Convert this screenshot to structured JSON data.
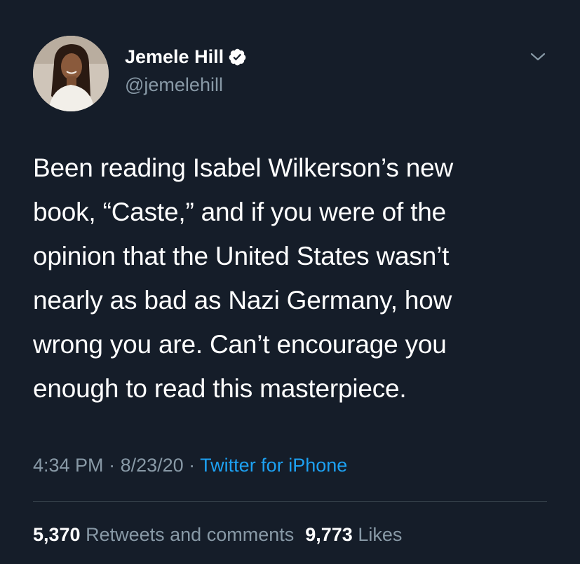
{
  "author": {
    "display_name": "Jemele Hill",
    "handle": "@jemelehill",
    "avatar_icon": "user-avatar",
    "verified_icon": "verified-badge-icon"
  },
  "menu": {
    "icon": "chevron-down-icon"
  },
  "tweet": {
    "lines": [
      "Been reading Isabel Wilkerson’s new",
      "book, “Caste,” and if you were of the",
      "opinion that the United States wasn’t",
      "nearly as bad as Nazi Germany, how",
      "wrong you are. Can’t encourage you",
      "enough to read this masterpiece."
    ]
  },
  "meta": {
    "time": "4:34 PM",
    "separator": " · ",
    "date": "8/23/20",
    "source": "Twitter for iPhone"
  },
  "stats": {
    "retweets_count": "5,370",
    "retweets_label": "Retweets and comments",
    "likes_count": "9,773",
    "likes_label": "Likes"
  },
  "colors": {
    "background": "#151d29",
    "text_primary": "#ffffff",
    "text_secondary": "#8899a6",
    "link": "#1da1f2",
    "divider": "#38444d"
  }
}
